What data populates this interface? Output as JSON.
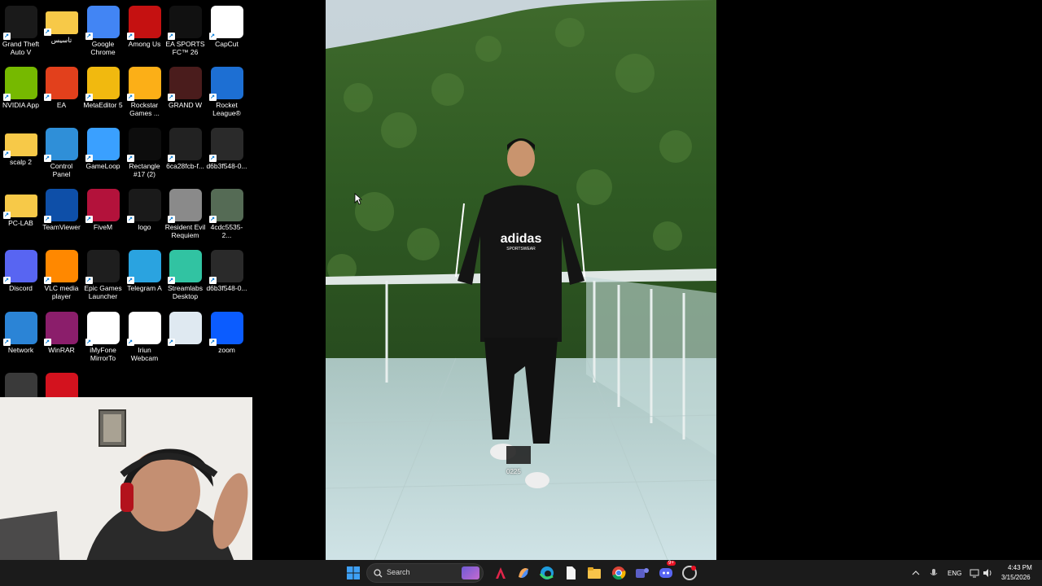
{
  "desktop": {
    "icons": [
      {
        "label": "Grand Theft Auto V",
        "icon": "gta-v-icon",
        "color": "#1a1a1a"
      },
      {
        "label": "تاسيس",
        "icon": "folder-icon",
        "color": "#f7c948"
      },
      {
        "label": "Google Chrome",
        "icon": "chrome-icon",
        "color": "#4285f4"
      },
      {
        "label": "Among Us",
        "icon": "among-us-icon",
        "color": "#c51111"
      },
      {
        "label": "EA SPORTS FC™ 26",
        "icon": "ea-fc-icon",
        "color": "#111111"
      },
      {
        "label": "CapCut",
        "icon": "capcut-icon",
        "color": "#ffffff"
      },
      {
        "label": "NVIDIA App",
        "icon": "nvidia-icon",
        "color": "#76b900"
      },
      {
        "label": "EA",
        "icon": "ea-icon",
        "color": "#e2401c"
      },
      {
        "label": "MetaEditor 5",
        "icon": "metaeditor-icon",
        "color": "#f1b90f"
      },
      {
        "label": "Rockstar Games ...",
        "icon": "rockstar-icon",
        "color": "#fcaf17"
      },
      {
        "label": "GRAND W",
        "icon": "image-file-icon",
        "color": "#4a1c1c"
      },
      {
        "label": "Rocket League®",
        "icon": "rocket-league-icon",
        "color": "#1d6fd3"
      },
      {
        "label": "scalp 2",
        "icon": "folder-icon",
        "color": "#f7c948"
      },
      {
        "label": "Control Panel",
        "icon": "control-panel-icon",
        "color": "#2f8fd8"
      },
      {
        "label": "GameLoop",
        "icon": "gameloop-icon",
        "color": "#3aa0ff"
      },
      {
        "label": "Rectangle #17 (2)",
        "icon": "image-file-icon",
        "color": "#0d0d0d"
      },
      {
        "label": "6ca28fcb-f...",
        "icon": "image-file-icon",
        "color": "#222222"
      },
      {
        "label": "d6b3f548-0...",
        "icon": "image-file-icon",
        "color": "#2a2a2a"
      },
      {
        "label": "PC-LAB",
        "icon": "folder-icon",
        "color": "#f7c948"
      },
      {
        "label": "TeamViewer",
        "icon": "teamviewer-icon",
        "color": "#0e4fa8"
      },
      {
        "label": "FiveM",
        "icon": "fivem-icon",
        "color": "#b3123b"
      },
      {
        "label": "logo",
        "icon": "image-file-icon",
        "color": "#1a1a1a"
      },
      {
        "label": "Resident Evil Requiem",
        "icon": "image-file-icon",
        "color": "#8a8a8a"
      },
      {
        "label": "4cdc5535-2...",
        "icon": "image-file-icon",
        "color": "#556b55"
      },
      {
        "label": "Discord",
        "icon": "discord-icon",
        "color": "#5865f2"
      },
      {
        "label": "VLC media player",
        "icon": "vlc-icon",
        "color": "#ff8800"
      },
      {
        "label": "Epic Games Launcher",
        "icon": "epic-games-icon",
        "color": "#1e1e1e"
      },
      {
        "label": "Telegram A",
        "icon": "telegram-icon",
        "color": "#2aa3e0"
      },
      {
        "label": "Streamlabs Desktop",
        "icon": "streamlabs-icon",
        "color": "#31c3a2"
      },
      {
        "label": "d6b3f548-0...",
        "icon": "image-file-icon",
        "color": "#2a2a2a"
      },
      {
        "label": "Network",
        "icon": "network-icon",
        "color": "#2b84d6"
      },
      {
        "label": "WinRAR",
        "icon": "winrar-icon",
        "color": "#8b1e6b"
      },
      {
        "label": "iMyFone MirrorTo",
        "icon": "imyfone-icon",
        "color": "#ffffff"
      },
      {
        "label": "Iriun Webcam",
        "icon": "iriun-icon",
        "color": "#ffffff"
      },
      {
        "label": "",
        "icon": "recycle-bin-icon",
        "color": "#dfe9f1"
      },
      {
        "label": "zoom",
        "icon": "zoom-icon",
        "color": "#0b5cff"
      },
      {
        "label": "",
        "icon": "image-file-icon",
        "color": "#3a3a3a"
      },
      {
        "label": "",
        "icon": "faceit-icon",
        "color": "#d3121e"
      }
    ]
  },
  "wallpaper": {
    "overlay_label": "0225",
    "shirt_text": "adidas",
    "shirt_subtext": "SPORTSWEAR"
  },
  "taskbar": {
    "search_placeholder": "Search",
    "apps": [
      "start-icon",
      "widget-icon",
      "fivem-icon",
      "copilot-icon",
      "edge-icon",
      "file-icon",
      "file-explorer-icon",
      "chrome-icon",
      "teams-icon",
      "discord-icon",
      "faceit-icon"
    ],
    "discord_badge": "9+",
    "language": "ENG",
    "time": "4:43 PM",
    "date": "3/15/2026"
  }
}
